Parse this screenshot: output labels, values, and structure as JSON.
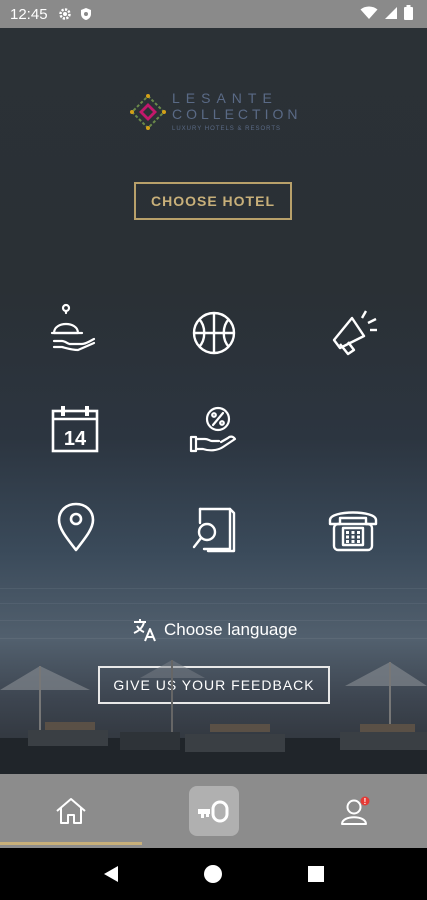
{
  "status_bar": {
    "time": "12:45"
  },
  "logo": {
    "line1": "LESANTE",
    "line2": "COLLECTION",
    "line3": "LUXURY HOTELS & RESORTS"
  },
  "buttons": {
    "choose_hotel": "CHOOSE HOTEL",
    "language": "Choose language",
    "feedback": "GIVE US YOUR FEEDBACK"
  },
  "icons": [
    {
      "name": "room-service-icon"
    },
    {
      "name": "basketball-icon"
    },
    {
      "name": "megaphone-icon"
    },
    {
      "name": "calendar-icon",
      "label": "14"
    },
    {
      "name": "offers-percent-icon"
    },
    {
      "name": "location-pin-icon"
    },
    {
      "name": "search-document-icon"
    },
    {
      "name": "telephone-icon"
    }
  ],
  "tab_bar": {
    "items": [
      "home-icon",
      "key-icon",
      "profile-icon"
    ],
    "badge": "!"
  },
  "colors": {
    "accent_gold": "#c8b07a",
    "background": "#2b3136",
    "tab_bar": "#8c8c8c",
    "badge": "#e53935"
  }
}
